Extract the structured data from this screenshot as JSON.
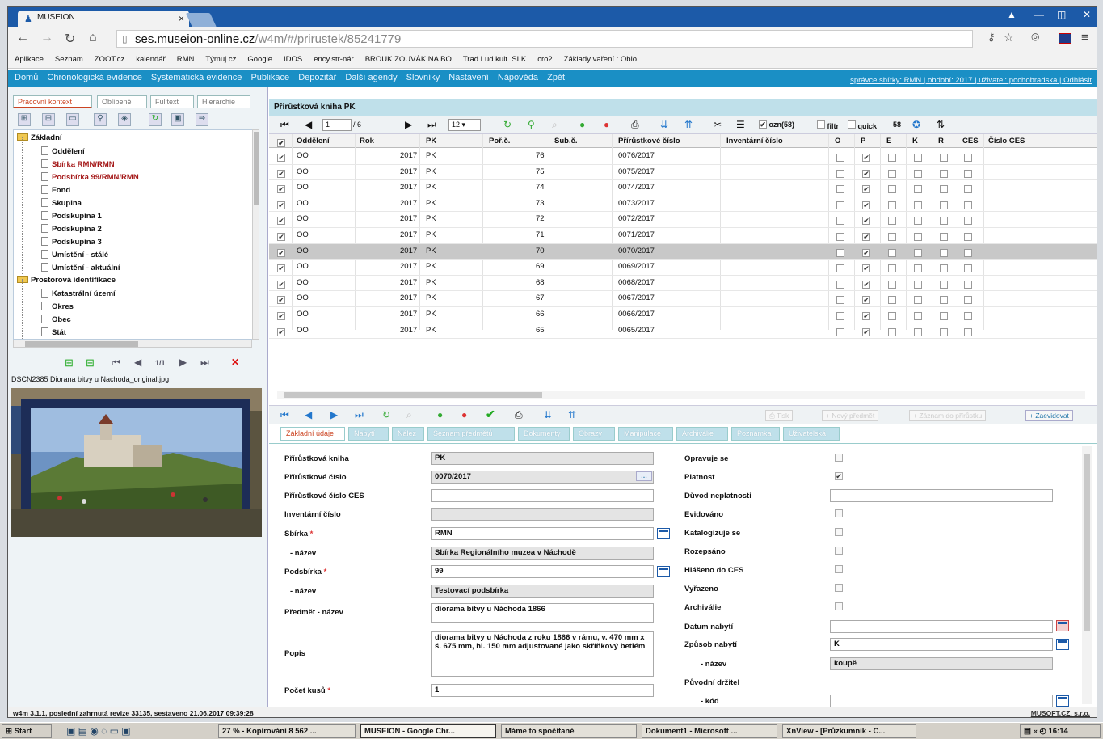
{
  "browser": {
    "tab_title": "MUSEION",
    "url_domain": "ses.museion-online.cz",
    "url_path": "/w4m/#/prirustek/85241779",
    "bookmarks": [
      "Aplikace",
      "Seznam",
      "ZOOT.cz",
      "kalendář",
      "RMN",
      "Týmuj.cz",
      "Google",
      "IDOS",
      "ency.str-nár",
      "BROUK ZOUVÁK NA BO",
      "Trad.Lud.kult. SLK",
      "cro2",
      "Základy vaření : Oblo"
    ]
  },
  "app_menu": {
    "items": [
      "Domů",
      "Chronologická evidence",
      "Systematická evidence",
      "Publikace",
      "Depozitář",
      "Další agendy",
      "Slovníky",
      "Nastavení",
      "Nápověda",
      "Zpět"
    ],
    "user_info": "správce sbírky: RMN | období: 2017 | uživatel: pochobradska | Odhlásit"
  },
  "left": {
    "tabs": [
      "Pracovní kontext",
      "Oblíbené",
      "Fulltext",
      "Hierarchie"
    ],
    "tree": [
      {
        "label": "Základní",
        "level": 0,
        "folder": true,
        "red": false
      },
      {
        "label": "Oddělení",
        "level": 1,
        "folder": false,
        "red": false
      },
      {
        "label": "Sbírka RMN/RMN",
        "level": 1,
        "folder": false,
        "red": true
      },
      {
        "label": "Podsbírka 99/RMN/RMN",
        "level": 1,
        "folder": false,
        "red": true
      },
      {
        "label": "Fond",
        "level": 1,
        "folder": false,
        "red": false
      },
      {
        "label": "Skupina",
        "level": 1,
        "folder": false,
        "red": false
      },
      {
        "label": "Podskupina 1",
        "level": 1,
        "folder": false,
        "red": false
      },
      {
        "label": "Podskupina 2",
        "level": 1,
        "folder": false,
        "red": false
      },
      {
        "label": "Podskupina 3",
        "level": 1,
        "folder": false,
        "red": false
      },
      {
        "label": "Umístění - stálé",
        "level": 1,
        "folder": false,
        "red": false
      },
      {
        "label": "Umístění - aktuální",
        "level": 1,
        "folder": false,
        "red": false
      },
      {
        "label": "Prostorová identifikace",
        "level": 0,
        "folder": true,
        "red": false
      },
      {
        "label": "Katastrální území",
        "level": 1,
        "folder": false,
        "red": false
      },
      {
        "label": "Okres",
        "level": 1,
        "folder": false,
        "red": false
      },
      {
        "label": "Obec",
        "level": 1,
        "folder": false,
        "red": false
      },
      {
        "label": "Stát",
        "level": 1,
        "folder": false,
        "red": false
      }
    ],
    "image_pager": "1/1",
    "image_filename": "DSCN2385 Diorana bitvy u Nachoda_original.jpg"
  },
  "grid": {
    "title": "Přírůstková kniha PK",
    "pager": {
      "page": "1",
      "total": "/ 6",
      "page_size": "12"
    },
    "options": {
      "ozn_label": "ozn(58)",
      "filtr_label": "filtr",
      "quick_label": "quick",
      "count": "58"
    },
    "columns": [
      "Oddělení",
      "Rok",
      "PK",
      "Poř.č.",
      "Sub.č.",
      "Přírůstkové číslo",
      "Inventární číslo",
      "O",
      "P",
      "E",
      "K",
      "R",
      "CES",
      "Číslo CES"
    ],
    "rows": [
      {
        "odd": "OO",
        "rok": "2017",
        "pk": "PK",
        "por": "76",
        "cislo": "0076/2017",
        "sel": false
      },
      {
        "odd": "OO",
        "rok": "2017",
        "pk": "PK",
        "por": "75",
        "cislo": "0075/2017",
        "sel": false
      },
      {
        "odd": "OO",
        "rok": "2017",
        "pk": "PK",
        "por": "74",
        "cislo": "0074/2017",
        "sel": false
      },
      {
        "odd": "OO",
        "rok": "2017",
        "pk": "PK",
        "por": "73",
        "cislo": "0073/2017",
        "sel": false
      },
      {
        "odd": "OO",
        "rok": "2017",
        "pk": "PK",
        "por": "72",
        "cislo": "0072/2017",
        "sel": false
      },
      {
        "odd": "OO",
        "rok": "2017",
        "pk": "PK",
        "por": "71",
        "cislo": "0071/2017",
        "sel": false
      },
      {
        "odd": "OO",
        "rok": "2017",
        "pk": "PK",
        "por": "70",
        "cislo": "0070/2017",
        "sel": true
      },
      {
        "odd": "OO",
        "rok": "2017",
        "pk": "PK",
        "por": "69",
        "cislo": "0069/2017",
        "sel": false
      },
      {
        "odd": "OO",
        "rok": "2017",
        "pk": "PK",
        "por": "68",
        "cislo": "0068/2017",
        "sel": false
      },
      {
        "odd": "OO",
        "rok": "2017",
        "pk": "PK",
        "por": "67",
        "cislo": "0067/2017",
        "sel": false
      },
      {
        "odd": "OO",
        "rok": "2017",
        "pk": "PK",
        "por": "66",
        "cislo": "0066/2017",
        "sel": false
      },
      {
        "odd": "OO",
        "rok": "2017",
        "pk": "PK",
        "por": "65",
        "cislo": "0065/2017",
        "sel": false
      }
    ]
  },
  "detail": {
    "actions": [
      "Tisk",
      "Nový předmět",
      "Záznam do přírůstku",
      "Zaevidovat"
    ],
    "tabs": [
      "Základní údaje",
      "Nabytí",
      "Nález",
      "Seznam předmětů",
      "Dokumenty",
      "Obrazy",
      "Manipulace",
      "Archiválie",
      "Poznámka",
      "Uživatelská"
    ],
    "left_fields": [
      {
        "label": "Přírůstková kniha",
        "value": "PK",
        "req": false
      },
      {
        "label": "Přírůstkové číslo",
        "value": "0070/2017",
        "req": false
      },
      {
        "label": "Přírůstkové číslo CES",
        "value": "",
        "req": false
      },
      {
        "label": "Inventární číslo",
        "value": "",
        "req": false
      },
      {
        "label": "Sbírka",
        "value": "RMN",
        "req": true
      },
      {
        "label": "- název",
        "value": "Sbírka Regionálního muzea v Náchodě",
        "req": false
      },
      {
        "label": "Podsbírka",
        "value": "99",
        "req": true
      },
      {
        "label": "- název",
        "value": "Testovací podsbírka",
        "req": false
      },
      {
        "label": "Předmět - název",
        "value": "diorama bitvy u Náchoda 1866",
        "req": false
      },
      {
        "label": "Popis",
        "value": "diorama bitvy u Náchoda z roku 1866 v rámu, v. 470 mm x š. 675 mm, hl. 150 mm adjustované jako skříňkový betlém",
        "req": false
      },
      {
        "label": "Počet kusů",
        "value": "1",
        "req": true
      }
    ],
    "right_fields": [
      {
        "label": "Opravuje se",
        "value": "",
        "check": false
      },
      {
        "label": "Platnost",
        "value": "",
        "check": true
      },
      {
        "label": "Důvod neplatnosti",
        "value": "",
        "check": false
      },
      {
        "label": "Evidováno",
        "value": "",
        "check": false
      },
      {
        "label": "Katalogizuje se",
        "value": "",
        "check": false
      },
      {
        "label": "Rozepsáno",
        "value": "",
        "check": false
      },
      {
        "label": "Hlášeno do CES",
        "value": "",
        "check": false
      },
      {
        "label": "Vyřazeno",
        "value": "",
        "check": false
      },
      {
        "label": "Archiválie",
        "value": "",
        "check": false
      },
      {
        "label": "Datum nabytí",
        "value": "",
        "check": false
      },
      {
        "label": "Způsob nabytí",
        "value": "K",
        "check": false
      },
      {
        "label": "- název",
        "value": "koupě",
        "check": false
      },
      {
        "label": "Původní držitel",
        "value": "",
        "check": false
      },
      {
        "label": "- kód",
        "value": "",
        "check": false
      }
    ]
  },
  "status": {
    "left": "w4m 3.1.1, poslední zahrnutá revize 33135, sestaveno 21.06.2017 09:39:28",
    "right": "MUSOFT.CZ, s.r.o."
  },
  "taskbar": {
    "start": "Start",
    "buttons": [
      "27 % - Kopírování 8 562 ...",
      "MUSEION - Google Chr...",
      "Máme to spočítané",
      "Dokument1 - Microsoft ...",
      "XnView - [Průzkumník - C..."
    ],
    "clock": "16:14"
  }
}
